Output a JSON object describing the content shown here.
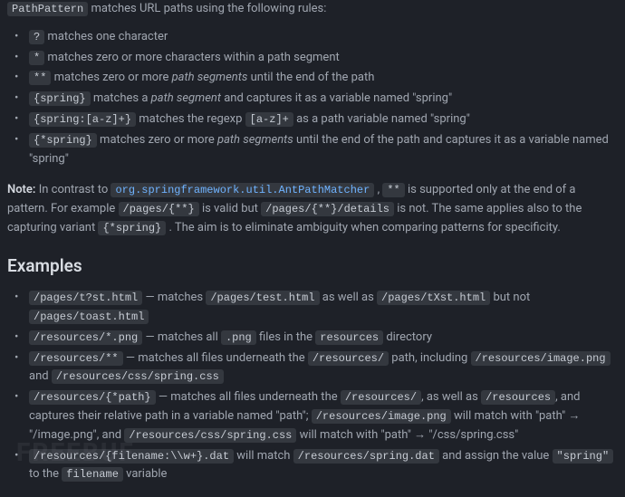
{
  "intro": {
    "code": "PathPattern",
    "after": " matches URL paths using the following rules:"
  },
  "rules": [
    {
      "c": "?",
      "t": " matches one character"
    },
    {
      "c": "*",
      "t": " matches zero or more characters within a path segment"
    },
    {
      "c": "**",
      "t1": " matches zero or more ",
      "em": "path segments",
      "t2": " until the end of the path"
    },
    {
      "c": "{spring}",
      "t1": " matches a ",
      "em": "path segment",
      "t2": " and captures it as a variable named \"spring\""
    },
    {
      "c": "{spring:[a-z]+}",
      "t1": " matches the regexp ",
      "c2": "[a-z]+",
      "t2": " as a path variable named \"spring\""
    },
    {
      "c": "{*spring}",
      "t1": " matches zero or more ",
      "em": "path segments",
      "t2": " until the end of the path and captures it as a variable named \"spring\""
    }
  ],
  "note": {
    "label": "Note:",
    "t1": " In contrast to ",
    "c1": "org.springframework.util.AntPathMatcher",
    "t2": ", ",
    "c2": "**",
    "t3": " is supported only at the end of a pattern. For example ",
    "c3": "/pages/{**}",
    "t4": " is valid but ",
    "c4": "/pages/{**}/details",
    "t5": " is not. The same applies also to the capturing variant ",
    "c5": "{*spring}",
    "t6": ". The aim is to eliminate ambiguity when comparing patterns for specificity."
  },
  "examples_heading": "Examples",
  "examples": [
    {
      "parts": [
        {
          "c": "/pages/t?st.html"
        },
        {
          "t": " — matches "
        },
        {
          "c": "/pages/test.html"
        },
        {
          "t": " as well as "
        },
        {
          "c": "/pages/tXst.html"
        },
        {
          "t": " but not "
        },
        {
          "c": "/pages/toast.html"
        }
      ]
    },
    {
      "parts": [
        {
          "c": "/resources/*.png"
        },
        {
          "t": " — matches all "
        },
        {
          "c": ".png"
        },
        {
          "t": " files in the "
        },
        {
          "c": "resources"
        },
        {
          "t": " directory"
        }
      ]
    },
    {
      "parts": [
        {
          "c": "/resources/**"
        },
        {
          "t": " — matches all files underneath the "
        },
        {
          "c": "/resources/"
        },
        {
          "t": " path, including "
        },
        {
          "c": "/resources/image.png"
        },
        {
          "t": " and "
        },
        {
          "c": "/resources/css/spring.css"
        }
      ]
    },
    {
      "parts": [
        {
          "c": "/resources/{*path}"
        },
        {
          "t": " — matches all files underneath the "
        },
        {
          "c": "/resources/"
        },
        {
          "t": ", as well as "
        },
        {
          "c": "/resources"
        },
        {
          "t": ", and captures their relative path in a variable named \"path\"; "
        },
        {
          "c": "/resources/image.png"
        },
        {
          "t": " will match with \"path\" → \"/image.png\", and "
        },
        {
          "c": "/resources/css/spring.css"
        },
        {
          "t": " will match with \"path\" → \"/css/spring.css\""
        }
      ]
    },
    {
      "parts": [
        {
          "c": "/resources/{filename:\\\\w+}.dat"
        },
        {
          "t": " will match "
        },
        {
          "c": "/resources/spring.dat"
        },
        {
          "t": " and assign the value "
        },
        {
          "c": "\"spring\""
        },
        {
          "t": " to the "
        },
        {
          "c": "filename"
        },
        {
          "t": " variable"
        }
      ]
    }
  ],
  "watermark": "FREEBUF"
}
